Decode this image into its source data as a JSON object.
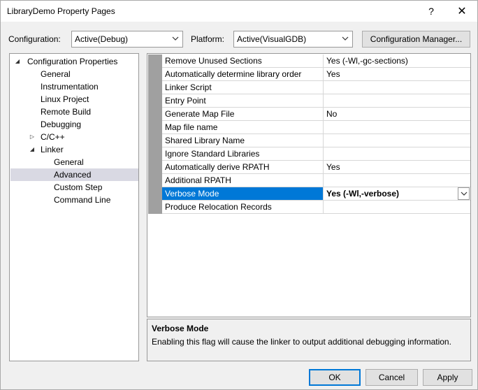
{
  "window": {
    "title": "LibraryDemo Property Pages",
    "help_glyph": "?",
    "close_glyph": "✕"
  },
  "toolbar": {
    "configuration_label": "Configuration:",
    "configuration_value": "Active(Debug)",
    "platform_label": "Platform:",
    "platform_value": "Active(VisualGDB)",
    "config_manager_label": "Configuration Manager..."
  },
  "tree": {
    "items": [
      {
        "label": "Configuration Properties",
        "arrow": "◢"
      },
      {
        "label": "General"
      },
      {
        "label": "Instrumentation"
      },
      {
        "label": "Linux Project"
      },
      {
        "label": "Remote Build"
      },
      {
        "label": "Debugging"
      },
      {
        "label": "C/C++",
        "arrow": "▷"
      },
      {
        "label": "Linker",
        "arrow": "◢"
      },
      {
        "label": "General"
      },
      {
        "label": "Advanced"
      },
      {
        "label": "Custom Step"
      },
      {
        "label": "Command Line"
      }
    ]
  },
  "grid": {
    "rows": [
      {
        "name": "Remove Unused Sections",
        "value": "Yes (-Wl,-gc-sections)"
      },
      {
        "name": "Automatically determine library order",
        "value": "Yes"
      },
      {
        "name": "Linker Script",
        "value": ""
      },
      {
        "name": "Entry Point",
        "value": ""
      },
      {
        "name": "Generate Map File",
        "value": "No"
      },
      {
        "name": "Map file name",
        "value": ""
      },
      {
        "name": "Shared Library Name",
        "value": ""
      },
      {
        "name": "Ignore Standard Libraries",
        "value": ""
      },
      {
        "name": "Automatically derive RPATH",
        "value": "Yes"
      },
      {
        "name": "Additional RPATH",
        "value": ""
      },
      {
        "name": "Verbose Mode",
        "value": "Yes (-Wl,-verbose)"
      },
      {
        "name": "Produce Relocation Records",
        "value": ""
      }
    ]
  },
  "description": {
    "title": "Verbose Mode",
    "text": "Enabling this flag will cause the linker to output additional debugging information."
  },
  "buttons": {
    "ok": "OK",
    "cancel": "Cancel",
    "apply": "Apply"
  },
  "colors": {
    "selection": "#0078d7",
    "tree_selection": "#d9d9e3",
    "gutter": "#a0a0a0"
  }
}
